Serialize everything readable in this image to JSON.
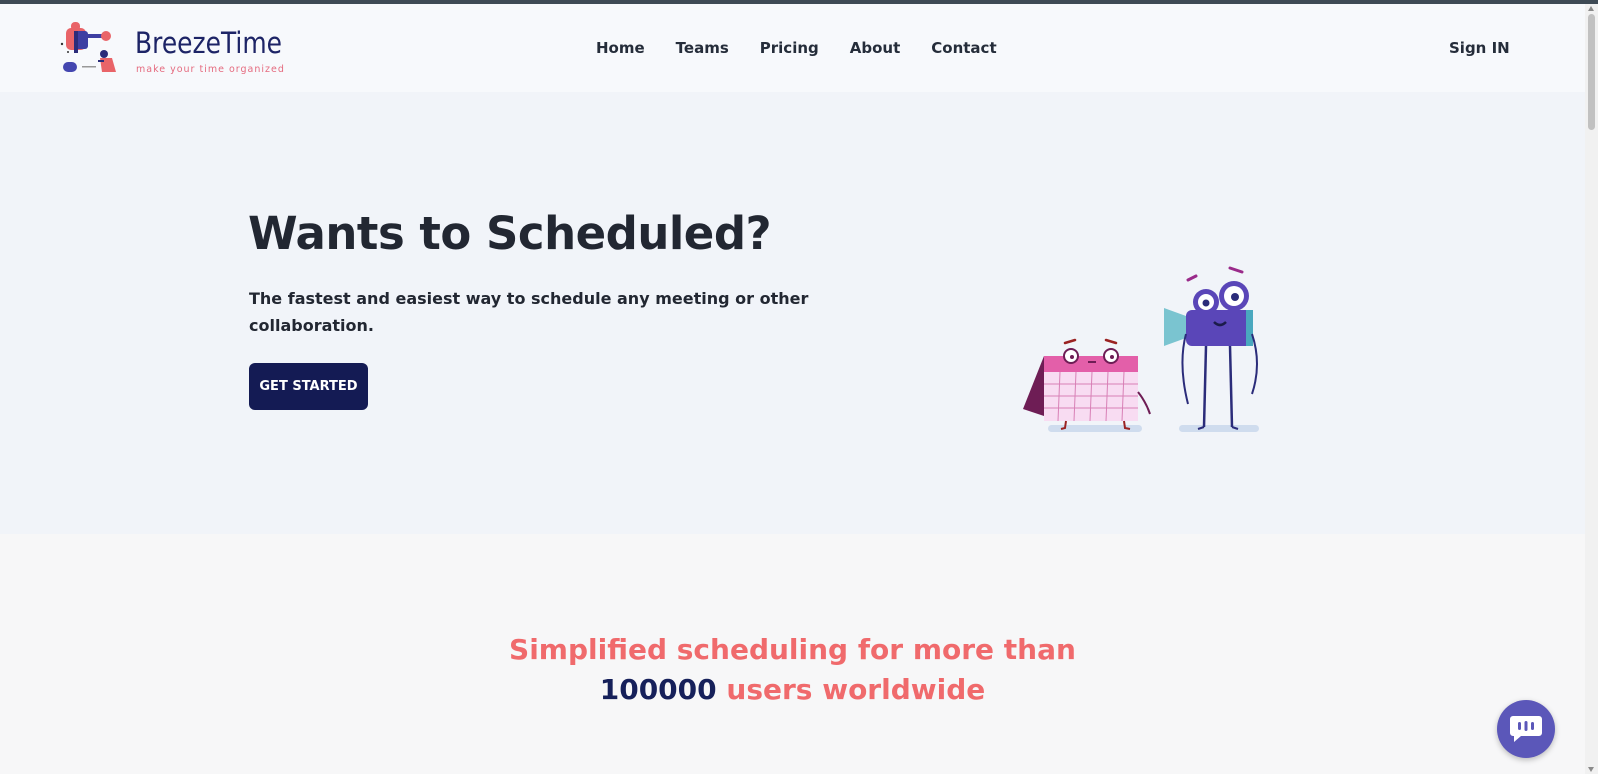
{
  "header": {
    "logo": {
      "name": "BreezeTime",
      "tagline": "make your time organized",
      "icon": "people-collaboration-logo"
    },
    "nav": [
      {
        "label": "Home"
      },
      {
        "label": "Teams"
      },
      {
        "label": "Pricing"
      },
      {
        "label": "About"
      },
      {
        "label": "Contact"
      }
    ],
    "sign_in_label": "Sign IN"
  },
  "hero": {
    "title": "Wants to Scheduled?",
    "subtitle": "The fastest and easiest way to schedule any meeting or other collaboration.",
    "cta_label": "GET STARTED",
    "illustration": "calendar-and-camera-characters"
  },
  "stats": {
    "title_line1": "Simplified scheduling for more than",
    "user_count": "100000",
    "title_line2_suffix": "users worldwide"
  },
  "chat_widget": {
    "icon": "chat-bubble-icon"
  },
  "colors": {
    "brand_navy": "#141b54",
    "accent_coral": "#f06a6c",
    "hero_bg": "#f1f4f9",
    "chat_purple": "#5b57b9",
    "text_dark": "#222732"
  }
}
